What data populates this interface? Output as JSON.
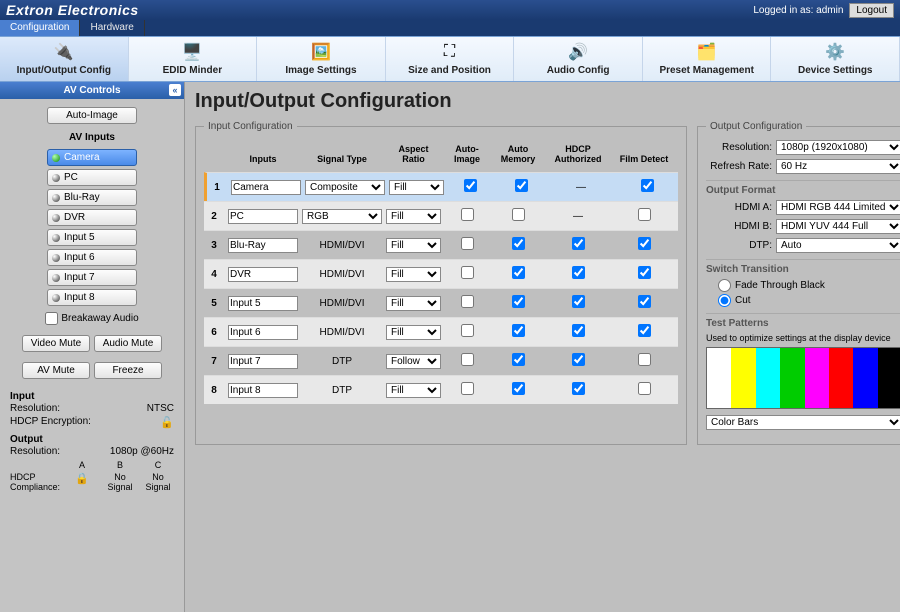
{
  "brand": "Extron Electronics",
  "logged_in": "Logged in as: admin",
  "logout": "Logout",
  "main_tabs": {
    "config": "Configuration",
    "hardware": "Hardware"
  },
  "nav": {
    "io": "Input/Output Config",
    "edid": "EDID Minder",
    "image": "Image Settings",
    "size": "Size and Position",
    "audio": "Audio Config",
    "preset": "Preset Management",
    "device": "Device Settings"
  },
  "av": {
    "title": "AV Controls",
    "auto": "Auto-Image",
    "inputs_lbl": "AV Inputs",
    "inputs": [
      "Camera",
      "PC",
      "Blu-Ray",
      "DVR",
      "Input 5",
      "Input 6",
      "Input 7",
      "Input 8"
    ],
    "breakaway": "Breakaway Audio",
    "vmute": "Video Mute",
    "amute": "Audio Mute",
    "avmute": "AV Mute",
    "freeze": "Freeze"
  },
  "status": {
    "in_h": "Input",
    "res_lbl": "Resolution:",
    "res_val": "NTSC",
    "hdcp_lbl": "HDCP Encryption:",
    "out_h": "Output",
    "out_res": "1080p @60Hz",
    "compl_lbl": "HDCP\nCompliance:",
    "cols": [
      "A",
      "B",
      "C"
    ],
    "vals": [
      "🔒",
      "No\nSignal",
      "No\nSignal"
    ]
  },
  "page_title": "Input/Output Configuration",
  "input_cfg": {
    "legend": "Input Configuration",
    "cols": {
      "inputs": "Inputs",
      "sig": "Signal Type",
      "aspect": "Aspect\nRatio",
      "auto": "Auto-\nImage",
      "mem": "Auto\nMemory",
      "hdcp": "HDCP\nAuthorized",
      "film": "Film Detect"
    },
    "rows": [
      {
        "n": "1",
        "name": "Camera",
        "sig_sel": "Composite",
        "sig_drop": true,
        "aspect": "Fill",
        "auto": true,
        "mem": true,
        "hdcp": "—",
        "film": true
      },
      {
        "n": "2",
        "name": "PC",
        "sig_sel": "RGB",
        "sig_drop": true,
        "aspect": "Fill",
        "auto": false,
        "mem": false,
        "hdcp": "—",
        "film": false
      },
      {
        "n": "3",
        "name": "Blu-Ray",
        "sig_txt": "HDMI/DVI",
        "aspect": "Fill",
        "auto": false,
        "mem": true,
        "hdcp_cb": true,
        "film": true
      },
      {
        "n": "4",
        "name": "DVR",
        "sig_txt": "HDMI/DVI",
        "aspect": "Fill",
        "auto": false,
        "mem": true,
        "hdcp_cb": true,
        "film": true
      },
      {
        "n": "5",
        "name": "Input 5",
        "sig_txt": "HDMI/DVI",
        "aspect": "Fill",
        "auto": false,
        "mem": true,
        "hdcp_cb": true,
        "film": true
      },
      {
        "n": "6",
        "name": "Input 6",
        "sig_txt": "HDMI/DVI",
        "aspect": "Fill",
        "auto": false,
        "mem": true,
        "hdcp_cb": true,
        "film": true
      },
      {
        "n": "7",
        "name": "Input 7",
        "sig_txt": "DTP",
        "aspect": "Follow",
        "auto": false,
        "mem": true,
        "hdcp_cb": true,
        "film": false
      },
      {
        "n": "8",
        "name": "Input 8",
        "sig_txt": "DTP",
        "aspect": "Fill",
        "auto": false,
        "mem": true,
        "hdcp_cb": true,
        "film": false
      }
    ]
  },
  "out_cfg": {
    "legend": "Output Configuration",
    "res_lbl": "Resolution:",
    "res": "1080p (1920x1080)",
    "rate_lbl": "Refresh Rate:",
    "rate": "60 Hz",
    "fmt": "Output Format",
    "hdmia_lbl": "HDMI A:",
    "hdmia": "HDMI RGB 444 Limited",
    "hdmib_lbl": "HDMI B:",
    "hdmib": "HDMI YUV 444 Full",
    "dtp_lbl": "DTP:",
    "dtp": "Auto",
    "trans": "Switch Transition",
    "fade": "Fade Through Black",
    "cut": "Cut",
    "tp": "Test Patterns",
    "tp_note": "Used to optimize settings at the display device",
    "tp_sel": "Color Bars"
  }
}
